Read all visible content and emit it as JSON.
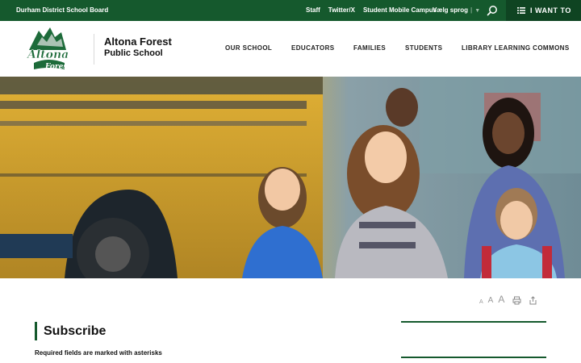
{
  "topbar": {
    "board": "Durham District School Board",
    "links": [
      "Staff",
      "Twitter/X",
      "Student Mobile Campus"
    ],
    "language": "Vælg sprog",
    "i_want_to": "I WANT TO"
  },
  "header": {
    "logo_text_top": "Altona",
    "logo_text_bottom": "Forest",
    "school_line1": "Altona Forest",
    "school_line2": "Public School",
    "nav": [
      "OUR SCHOOL",
      "EDUCATORS",
      "FAMILIES",
      "STUDENTS",
      "LIBRARY LEARNING COMMONS"
    ]
  },
  "tools": {
    "font_small": "A",
    "font_medium": "A",
    "font_large": "A"
  },
  "content": {
    "title": "Subscribe",
    "required_note": "Required fields are marked with asterisks"
  },
  "colors": {
    "brand_green": "#15592d",
    "dark_green": "#0f4422"
  }
}
